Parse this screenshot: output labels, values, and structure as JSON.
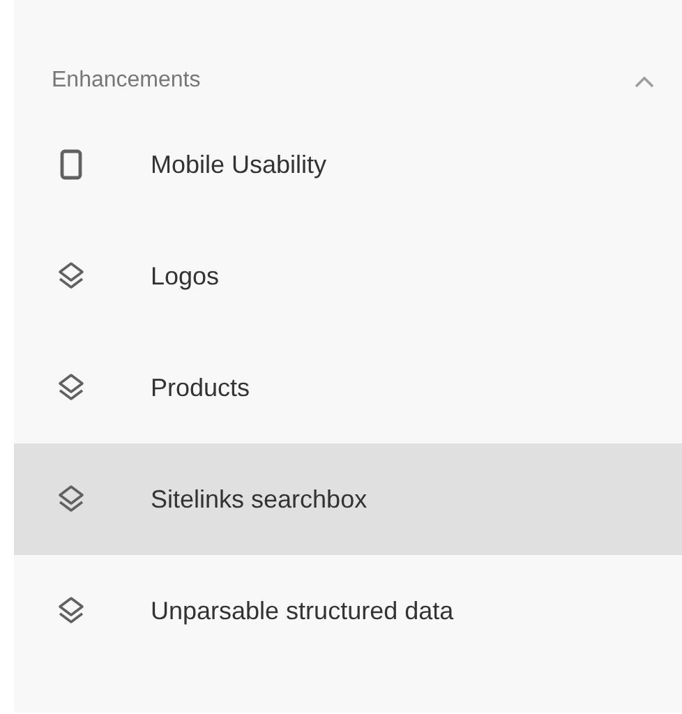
{
  "section": {
    "title": "Enhancements",
    "expanded": true
  },
  "items": [
    {
      "label": "Mobile Usability",
      "kind": "phone",
      "selected": false
    },
    {
      "label": "Logos",
      "kind": "layers",
      "selected": false
    },
    {
      "label": "Products",
      "kind": "layers",
      "selected": false
    },
    {
      "label": "Sitelinks searchbox",
      "kind": "layers",
      "selected": true
    },
    {
      "label": "Unparsable structured data",
      "kind": "layers",
      "selected": false
    }
  ]
}
